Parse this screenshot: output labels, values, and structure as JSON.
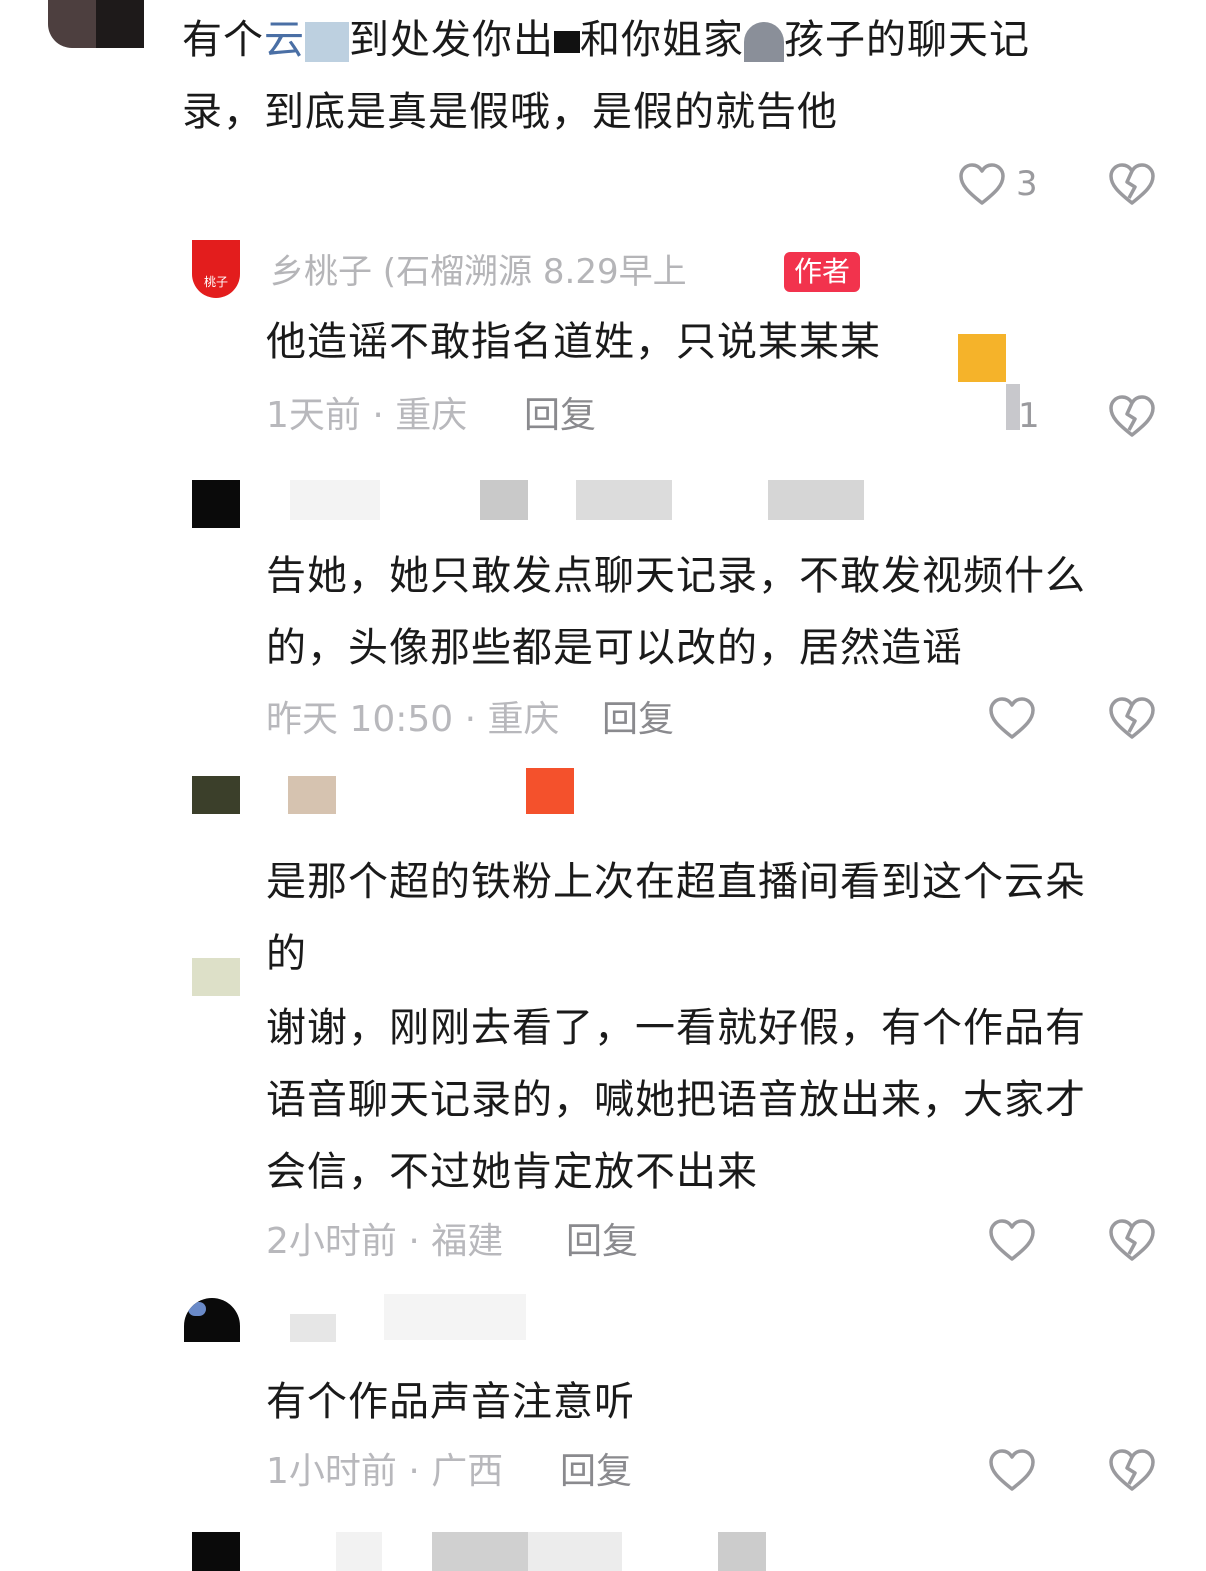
{
  "comments": [
    {
      "id": "c0",
      "text_lines": [
        "有个云",
        "到处发你出",
        "和你姐家",
        "孩子的聊天记",
        "录，到底是真是假哦，是假的就告他"
      ],
      "link_text": "云",
      "likes": "3"
    },
    {
      "id": "c1",
      "username": "乡桃子 (石榴溯源 8.29早上",
      "badge": "作者",
      "avatar_text": "桃子",
      "text": "他造谣不敢指名道姓，只说某某某",
      "time": "1天前 · 重庆",
      "reply": "回复",
      "likes": "1"
    },
    {
      "id": "c2",
      "text_lines": [
        "告她，她只敢发点聊天记录，不敢发视频什么",
        "的，头像那些都是可以改的，居然造谣"
      ],
      "time": "昨天 10:50 · 重庆",
      "reply": "回复"
    },
    {
      "id": "c3",
      "text_lines": [
        "是那个超的铁粉上次在超直播间看到这个云朵",
        "的"
      ],
      "reply_lines": [
        "谢谢，刚刚去看了，一看就好假，有个作品有",
        "语音聊天记录的，喊她把语音放出来，大家才",
        "会信，不过她肯定放不出来"
      ],
      "time": "2小时前 · 福建",
      "reply": "回复"
    },
    {
      "id": "c4",
      "text": "有个作品声音注意听",
      "time": "1小时前 · 广西",
      "reply": "回复"
    }
  ],
  "colors": {
    "badge": "#f2334d",
    "meta": "#b8b8bc",
    "text": "#1a1a1a",
    "orange_block": "#f5b32a",
    "red_block": "#f4512c"
  },
  "icons": {
    "like": "heart-outline-icon",
    "dislike": "broken-heart-icon"
  }
}
